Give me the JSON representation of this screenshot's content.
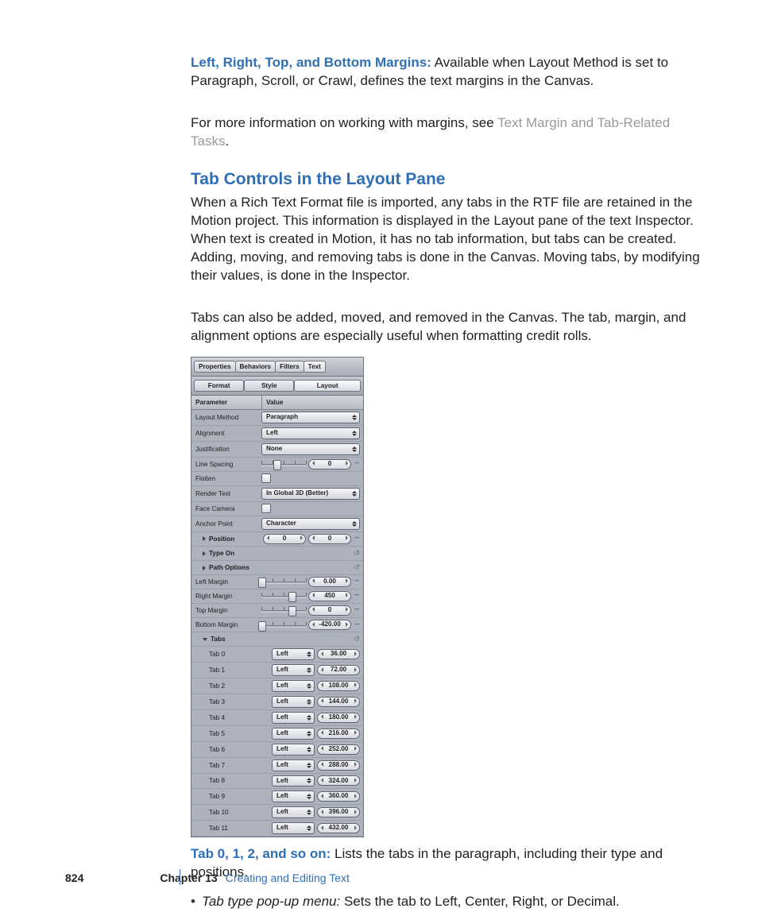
{
  "body": {
    "margins_term": "Left, Right, Top, and Bottom Margins:",
    "margins_text": "  Available when Layout Method is set to Paragraph, Scroll, or Crawl, defines the text margins in the Canvas.",
    "more_info_prefix": "For more information on working with margins, see ",
    "more_info_link": "Text Margin and Tab-Related Tasks",
    "more_info_suffix": ".",
    "heading": "Tab Controls in the Layout Pane",
    "intro_p1": "When a Rich Text Format file is imported, any tabs in the RTF file are retained in the Motion project. This information is displayed in the Layout pane of the text Inspector. When text is created in Motion, it has no tab information, but tabs can be created. Adding, moving, and removing tabs is done in the Canvas. Moving tabs, by modifying their values, is done in the Inspector.",
    "intro_p2": "Tabs can also be added, moved, and removed in the Canvas. The tab, margin, and alignment options are especially useful when formatting credit rolls.",
    "tabs_term": "Tab 0, 1, 2, and so on:",
    "tabs_text": "  Lists the tabs in the paragraph, including their type and positions.",
    "bullet_term": "Tab type pop-up menu:",
    "bullet_text": "  Sets the tab to Left, Center, Right, or Decimal."
  },
  "panel": {
    "top_tabs": [
      "Properties",
      "Behaviors",
      "Filters",
      "Text"
    ],
    "top_tabs_active": 3,
    "sub_tabs": [
      "Format",
      "Style",
      "Layout"
    ],
    "sub_tabs_active": 2,
    "header_left": "Parameter",
    "header_right": "Value",
    "rows": {
      "layout_method": {
        "label": "Layout Method",
        "value": "Paragraph"
      },
      "alignment": {
        "label": "Alignment",
        "value": "Left"
      },
      "justification": {
        "label": "Justification",
        "value": "None"
      },
      "line_spacing": {
        "label": "Line Spacing",
        "value": "0",
        "thumb": 0.35
      },
      "flatten": {
        "label": "Flatten"
      },
      "render_text": {
        "label": "Render Text",
        "value": "In Global 3D (Better)"
      },
      "face_camera": {
        "label": "Face Camera"
      },
      "anchor_point": {
        "label": "Anchor Point",
        "value": "Character"
      },
      "position": {
        "label": "Position",
        "x": "0",
        "y": "0"
      },
      "type_on": {
        "label": "Type On"
      },
      "path_options": {
        "label": "Path Options"
      },
      "left_margin": {
        "label": "Left Margin",
        "value": "0.00",
        "thumb": 0.02
      },
      "right_margin": {
        "label": "Right Margin",
        "value": "450",
        "thumb": 0.7
      },
      "top_margin": {
        "label": "Top Margin",
        "value": "0",
        "thumb": 0.7
      },
      "bottom_margin": {
        "label": "Bottom Margin",
        "value": "-420.00",
        "thumb": 0.02
      },
      "tabs_header": {
        "label": "Tabs"
      }
    },
    "tabs_list": [
      {
        "label": "Tab 0",
        "type": "Left",
        "value": "36.00"
      },
      {
        "label": "Tab 1",
        "type": "Left",
        "value": "72.00"
      },
      {
        "label": "Tab 2",
        "type": "Left",
        "value": "108.00"
      },
      {
        "label": "Tab 3",
        "type": "Left",
        "value": "144.00"
      },
      {
        "label": "Tab 4",
        "type": "Left",
        "value": "180.00"
      },
      {
        "label": "Tab 5",
        "type": "Left",
        "value": "216.00"
      },
      {
        "label": "Tab 6",
        "type": "Left",
        "value": "252.00"
      },
      {
        "label": "Tab 7",
        "type": "Left",
        "value": "288.00"
      },
      {
        "label": "Tab 8",
        "type": "Left",
        "value": "324.00"
      },
      {
        "label": "Tab 9",
        "type": "Left",
        "value": "360.00"
      },
      {
        "label": "Tab 10",
        "type": "Left",
        "value": "396.00"
      },
      {
        "label": "Tab 11",
        "type": "Left",
        "value": "432.00"
      }
    ]
  },
  "footer": {
    "page": "824",
    "chapter_label": "Chapter 13",
    "chapter_title": "Creating and Editing Text"
  }
}
